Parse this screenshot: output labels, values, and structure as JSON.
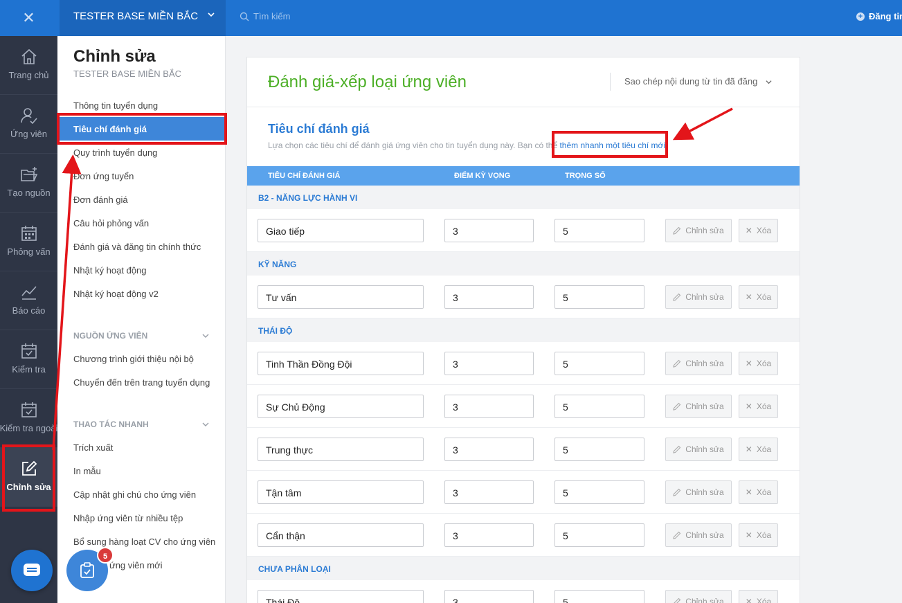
{
  "topbar": {
    "close_icon": "close-icon",
    "org_name": "TESTER BASE MIỀN BẮC",
    "search_placeholder": "Tìm kiếm",
    "right_action": "Đăng tin"
  },
  "iconbar": {
    "items": [
      {
        "label": "Trang chủ",
        "icon": "home-icon"
      },
      {
        "label": "Ứng viên",
        "icon": "user-check-icon"
      },
      {
        "label": "Tạo nguồn",
        "icon": "folder-plus-icon"
      },
      {
        "label": "Phỏng vấn",
        "icon": "calendar-grid-icon"
      },
      {
        "label": "Báo cáo",
        "icon": "line-chart-icon"
      },
      {
        "label": "Kiểm tra",
        "icon": "calendar-check-icon"
      },
      {
        "label": "Kiểm tra ngoài",
        "icon": "calendar-check-icon"
      },
      {
        "label": "Chỉnh sửa",
        "icon": "edit-icon",
        "active": true
      }
    ],
    "chat_icon": "chat-icon"
  },
  "subnav": {
    "title": "Chỉnh sửa",
    "subtitle": "TESTER BASE MIỀN BẮC",
    "items": [
      "Thông tin tuyển dụng",
      "Tiêu chí đánh giá",
      "Quy trình tuyển dụng",
      "Đơn ứng tuyển",
      "Đơn đánh giá",
      "Câu hỏi phỏng vấn",
      "Đánh giá và đăng tin chính thức",
      "Nhật ký hoạt động",
      "Nhật ký hoạt động v2"
    ],
    "active_item": "Tiêu chí đánh giá",
    "section_sources": "NGUỒN ỨNG VIÊN",
    "source_items": [
      "Chương trình giới thiệu nội bộ",
      "Chuyển đến trên trang tuyển dụng"
    ],
    "section_quick": "THAO TÁC NHANH",
    "quick_items": [
      "Trích xuất",
      "In mẫu",
      "Cập nhật ghi chú cho ứng viên",
      "Nhập ứng viên từ nhiều tệp",
      "Bổ sung hàng loạt CV cho ứng viên",
      "ứng viên mới"
    ],
    "task_badge": "5"
  },
  "main": {
    "title": "Đánh giá-xếp loại ứng viên",
    "copy_dropdown": "Sao chép nội dung từ tin đã đăng",
    "section_title": "Tiêu chí đánh giá",
    "section_desc": "Lựa chọn các tiêu chí để đánh giá ứng viên cho tin tuyển dụng này. Bạn có thể ",
    "section_link": "thêm nhanh một tiêu chí mới.",
    "columns": [
      "TIÊU CHÍ ĐÁNH GIÁ",
      "ĐIỂM KỲ VỌNG",
      "TRỌNG SỐ"
    ],
    "edit_label": "Chỉnh sửa",
    "delete_label": "Xóa",
    "groups": [
      {
        "name": "B2 - NĂNG LỰC HÀNH VI",
        "rows": [
          {
            "name": "Giao tiếp",
            "expected": "3",
            "weight": "5"
          }
        ]
      },
      {
        "name": "KỸ NĂNG",
        "rows": [
          {
            "name": "Tư vấn",
            "expected": "3",
            "weight": "5"
          }
        ]
      },
      {
        "name": "THÁI ĐỘ",
        "rows": [
          {
            "name": "Tinh Thần Đồng Đội",
            "expected": "3",
            "weight": "5"
          },
          {
            "name": "Sự Chủ Động",
            "expected": "3",
            "weight": "5"
          },
          {
            "name": "Trung thực",
            "expected": "3",
            "weight": "5"
          },
          {
            "name": "Tận tâm",
            "expected": "3",
            "weight": "5"
          },
          {
            "name": "Cẩn thận",
            "expected": "3",
            "weight": "5"
          }
        ]
      },
      {
        "name": "CHƯA PHÂN LOẠI",
        "rows": [
          {
            "name": "Thái Độ",
            "expected": "3",
            "weight": "5"
          }
        ]
      }
    ]
  },
  "annotations": {
    "color": "#e3151a"
  }
}
